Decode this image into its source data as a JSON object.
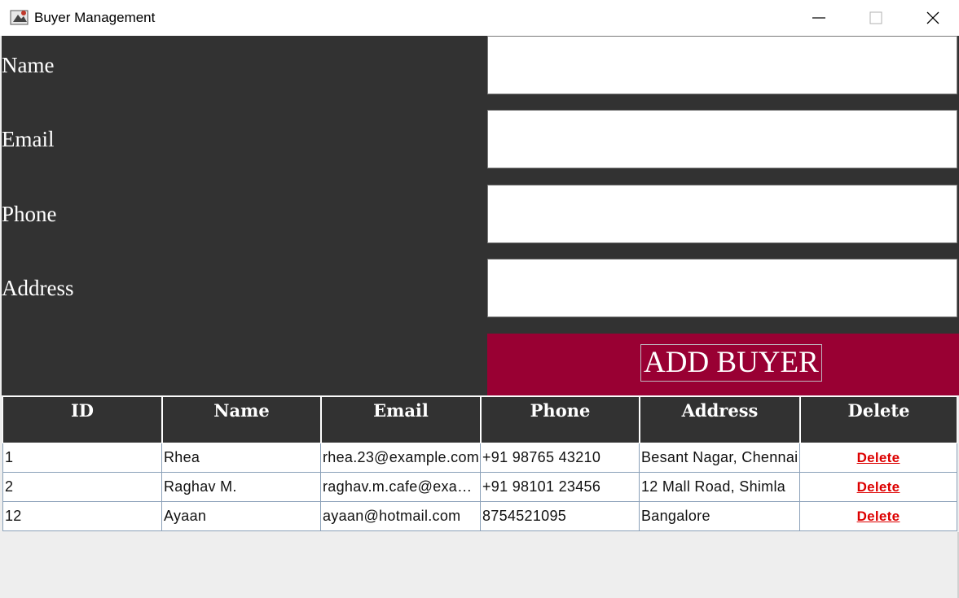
{
  "window": {
    "title": "Buyer Management",
    "icon": "java-app-icon"
  },
  "form": {
    "labels": {
      "name": "Name",
      "email": "Email",
      "phone": "Phone",
      "address": "Address"
    },
    "values": {
      "name": "",
      "email": "",
      "phone": "",
      "address": ""
    },
    "add_button_label": "ADD BUYER"
  },
  "table": {
    "headers": [
      "ID",
      "Name",
      "Email",
      "Phone",
      "Address",
      "Delete"
    ],
    "rows": [
      {
        "id": "1",
        "name": "Rhea",
        "email": "rhea.23@example.com",
        "phone": "+91 98765 43210",
        "address": "Besant Nagar, Chennai",
        "delete": "Delete"
      },
      {
        "id": "2",
        "name": "Raghav M.",
        "email": "raghav.m.cafe@example.com",
        "phone": "+91 98101 23456",
        "address": "12 Mall Road, Shimla",
        "delete": "Delete"
      },
      {
        "id": "12",
        "name": "Ayaan",
        "email": "ayaan@hotmail.com",
        "phone": "8754521095",
        "address": "Bangalore",
        "delete": "Delete"
      }
    ]
  },
  "colors": {
    "panel": "#323232",
    "accent": "#990033",
    "delete_link": "#dd0000"
  }
}
